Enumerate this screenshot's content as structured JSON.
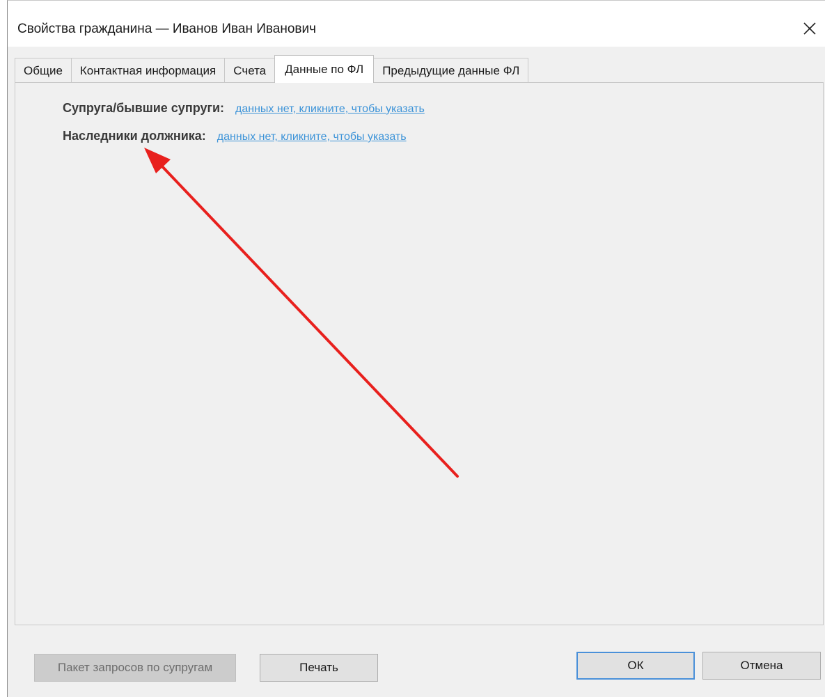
{
  "window": {
    "title": "Свойства гражданина — Иванов Иван Иванович",
    "close_icon": "close-icon"
  },
  "tabs": [
    {
      "label": "Общие",
      "active": false
    },
    {
      "label": "Контактная информация",
      "active": false
    },
    {
      "label": "Счета",
      "active": false
    },
    {
      "label": "Данные по ФЛ",
      "active": true
    },
    {
      "label": "Предыдущие данные ФЛ",
      "active": false
    }
  ],
  "fields": [
    {
      "label": "Супруга/бывшие супруги:",
      "link": "данных нет, кликните, чтобы указать"
    },
    {
      "label": "Наследники должника:",
      "link": "данных нет, кликните, чтобы указать"
    }
  ],
  "annotation": {
    "arrow_color": "#e8201d"
  },
  "buttons": {
    "spouse_requests": "Пакет запросов по супругам",
    "print": "Печать",
    "ok": "ОК",
    "cancel": "Отмена"
  }
}
